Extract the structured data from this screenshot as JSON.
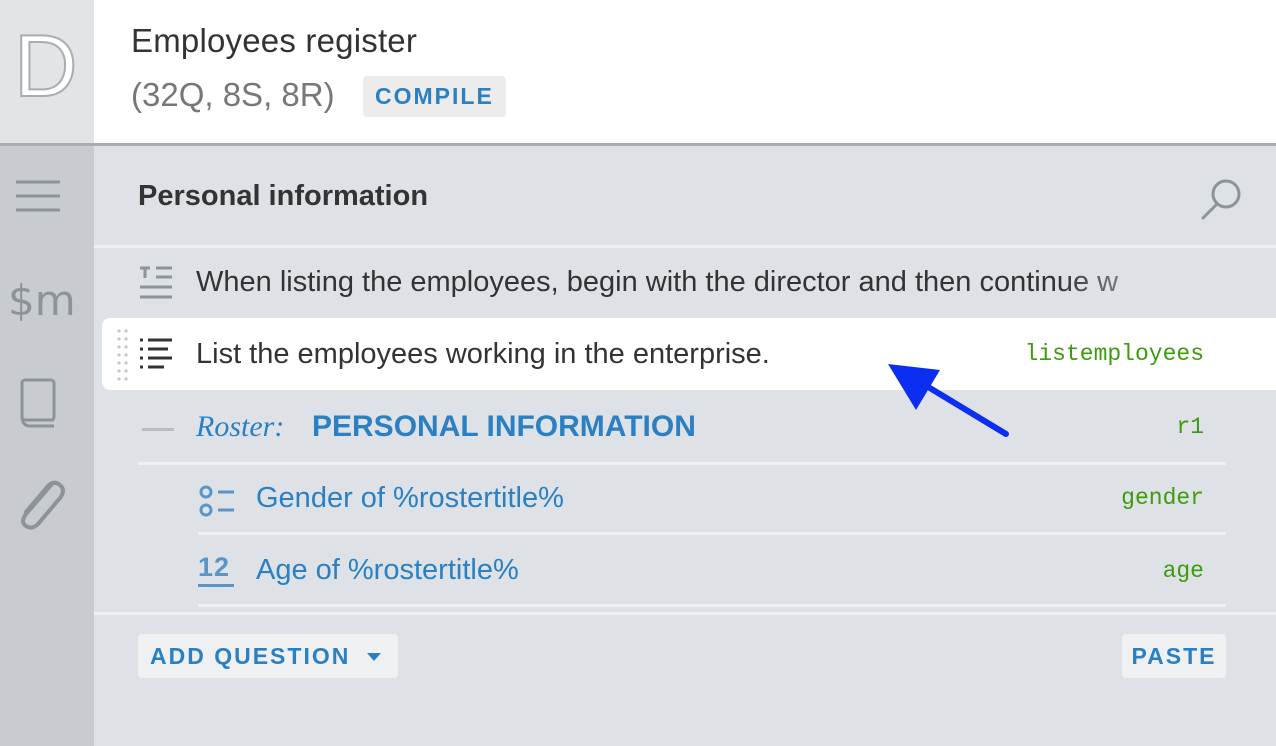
{
  "app": {
    "logo_letter": "D"
  },
  "header": {
    "title": "Employees register",
    "counts": "(32Q, 8S, 8R)",
    "compile_label": "COMPILE"
  },
  "rail": {
    "macros_label": "$m"
  },
  "section": {
    "title": "Personal information"
  },
  "items": [
    {
      "type": "static-text",
      "text": "When listing the employees, begin with the director and then continue w",
      "variable": ""
    },
    {
      "type": "text-list-question",
      "text": "List the employees working in the enterprise.",
      "variable": "listemployees"
    }
  ],
  "roster": {
    "label": "Roster:",
    "title": "PERSONAL INFORMATION",
    "variable": "r1",
    "children": [
      {
        "type": "single-choice",
        "text": "Gender of %rostertitle%",
        "variable": "gender"
      },
      {
        "type": "numeric",
        "icon_text": "12",
        "text": "Age of %rostertitle%",
        "variable": "age"
      }
    ]
  },
  "footer": {
    "add_question_label": "ADD QUESTION",
    "paste_label": "PASTE"
  },
  "colors": {
    "accent": "#2b7fc3",
    "variable": "#3d9c0c",
    "arrow": "#0b2ef0"
  }
}
